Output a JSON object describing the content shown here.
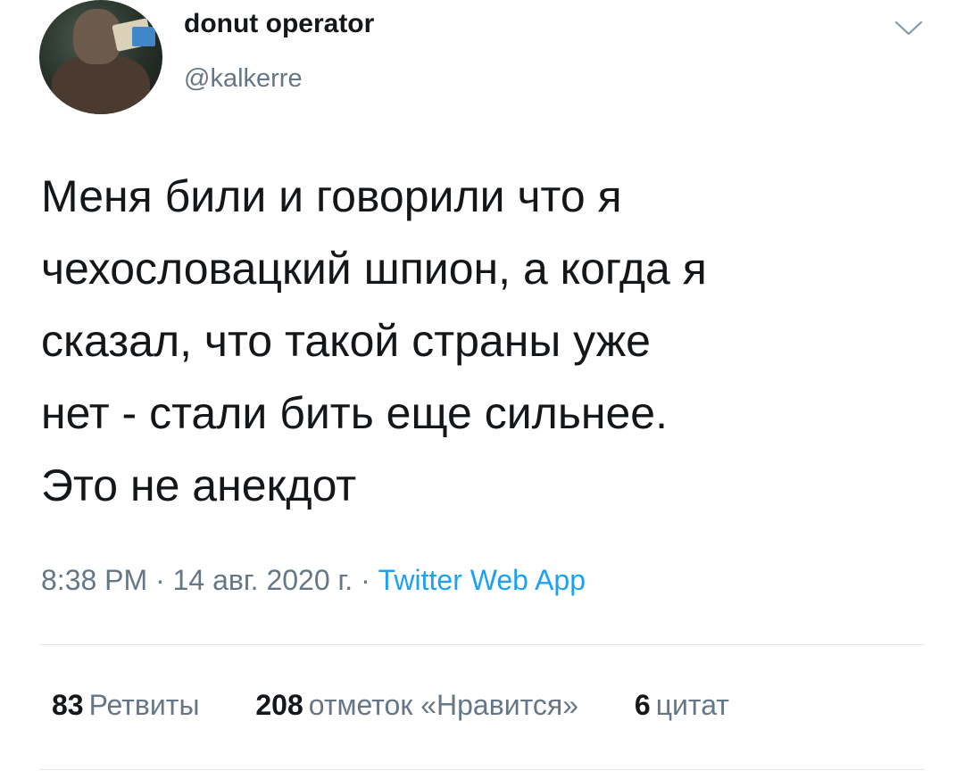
{
  "author": {
    "display_name": "donut operator",
    "handle": "@kalkerre"
  },
  "tweet": {
    "lines": [
      "Меня били и говорили что я",
      "чехословацкий шпион, а когда я",
      "сказал, что такой страны уже",
      "нет - стали бить еще сильнее.",
      "Это не анекдот"
    ],
    "time": "8:38 PM",
    "date": "14 авг. 2020 г.",
    "separator": "·",
    "source": "Twitter Web App"
  },
  "stats": {
    "retweets": {
      "count": "83",
      "label": "Ретвиты"
    },
    "likes": {
      "count": "208",
      "label": "отметок «Нравится»"
    },
    "quotes": {
      "count": "6",
      "label": "цитат"
    }
  },
  "icons": {
    "caret": "chevron-down-icon"
  },
  "colors": {
    "text": "#14171a",
    "secondary": "#657786",
    "link": "#1da1f2",
    "divider": "#e1e8ed"
  }
}
